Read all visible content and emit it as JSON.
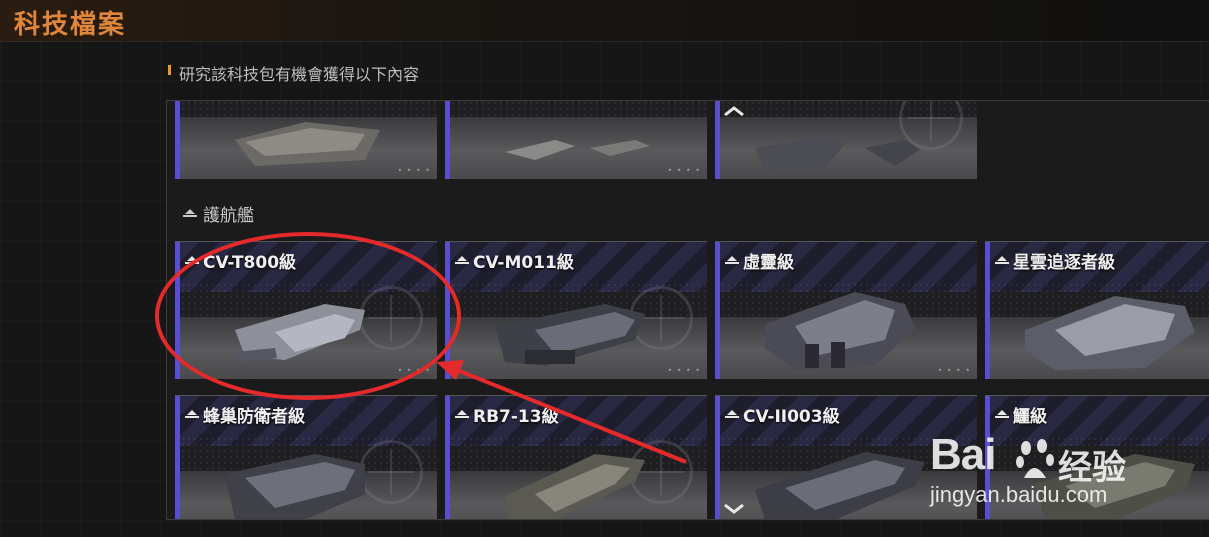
{
  "header": {
    "title": "科技檔案"
  },
  "description": {
    "text": "研究該科技包有機會獲得以下內容"
  },
  "section": {
    "label": "護航艦"
  },
  "top_row": [
    {
      "label": ""
    },
    {
      "label": ""
    },
    {
      "label": ""
    }
  ],
  "cards": [
    {
      "label": "CV-T800級"
    },
    {
      "label": "CV-M011級"
    },
    {
      "label": "虛靈級"
    },
    {
      "label": "星雲追逐者級"
    },
    {
      "label": "蜂巢防衛者級"
    },
    {
      "label": "RB7-13級"
    },
    {
      "label": "CV-II003級"
    },
    {
      "label": "鱷級"
    }
  ],
  "scroll": {
    "up_icon": "chevron-up-icon",
    "down_icon": "chevron-down-icon"
  },
  "watermark": {
    "brand": "Bai",
    "brand_cn": "经验",
    "url": "jingyan.baidu.com"
  },
  "colors": {
    "title": "#e0863a",
    "accent": "#5a4ed0",
    "annotation": "#e42a2a"
  }
}
